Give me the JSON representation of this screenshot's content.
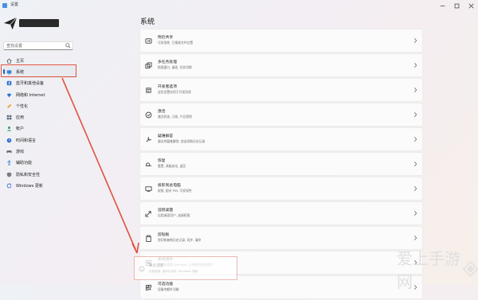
{
  "window": {
    "title": "设置"
  },
  "search": {
    "placeholder": "查找设置"
  },
  "sidebar": {
    "items": [
      {
        "label": "主页",
        "icon": "home-icon"
      },
      {
        "label": "系统",
        "icon": "system-icon",
        "active": true
      },
      {
        "label": "蓝牙和其他设备",
        "icon": "bluetooth-icon"
      },
      {
        "label": "网络和 Internet",
        "icon": "wifi-icon"
      },
      {
        "label": "个性化",
        "icon": "brush-icon"
      },
      {
        "label": "应用",
        "icon": "apps-icon"
      },
      {
        "label": "帐户",
        "icon": "account-icon"
      },
      {
        "label": "时间和语言",
        "icon": "globe-clock-icon"
      },
      {
        "label": "游戏",
        "icon": "gamepad-icon"
      },
      {
        "label": "辅助功能",
        "icon": "accessibility-icon"
      },
      {
        "label": "隐私和安全性",
        "icon": "shield-icon"
      },
      {
        "label": "Windows 更新",
        "icon": "windows-update-icon"
      }
    ]
  },
  "main": {
    "title": "系统",
    "cards": [
      {
        "title": "附近共享",
        "desc": "可发现性, 已接收文件位置",
        "icon": "share-icon"
      },
      {
        "title": "多任务处理",
        "desc": "贴靠窗口, 桌面, 任务切换",
        "icon": "multitask-icon"
      },
      {
        "title": "开发者选项",
        "desc": "这些设置仅用于开发用途",
        "icon": "developer-icon"
      },
      {
        "title": "激活",
        "desc": "激活状态, 订阅, 产品密钥",
        "icon": "activation-icon"
      },
      {
        "title": "疑难解答",
        "desc": "建议的疑难解答, 首选项和历史记录",
        "icon": "troubleshoot-icon"
      },
      {
        "title": "恢复",
        "desc": "重置, 高级启动, 返回",
        "icon": "recovery-icon"
      },
      {
        "title": "投影到此电脑",
        "desc": "权限, 配对 PIN, 可发现性",
        "icon": "projection-icon"
      },
      {
        "title": "远程桌面",
        "desc": "远程桌面用户, 连接权限",
        "icon": "remote-desktop-icon"
      },
      {
        "title": "剪贴板",
        "desc": "剪切和复制历史记录, 同步, 清除",
        "icon": "clipboard-icon"
      },
      {
        "title": "系统组件",
        "desc": "删除和管理 Windows 上预装的系统组件",
        "icon": "components-icon"
      },
      {
        "title": "可选功能",
        "desc": "设备的额外功能",
        "icon": "optional-features-icon"
      }
    ],
    "faded_card": {
      "title": "系统信息",
      "desc": "设备规格, 重命名电脑, Windows 规格"
    }
  },
  "watermark": {
    "text": "爱上手游网"
  },
  "colors": {
    "accent": "#0067c0",
    "annotation": "#e0523f"
  }
}
